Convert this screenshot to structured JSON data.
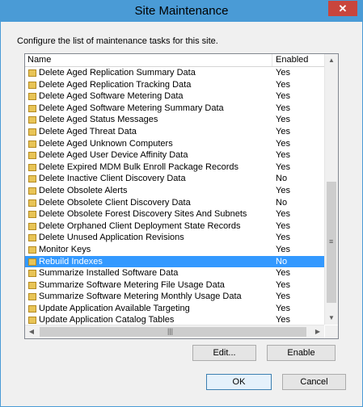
{
  "window": {
    "title": "Site Maintenance",
    "close_glyph": "✕"
  },
  "description": "Configure the list of maintenance tasks for this site.",
  "list": {
    "columns": {
      "name": "Name",
      "enabled": "Enabled"
    },
    "rows": [
      {
        "name": "Delete Aged Replication Summary Data",
        "enabled": "Yes",
        "icon": "task-folder-icon"
      },
      {
        "name": "Delete Aged Replication Tracking Data",
        "enabled": "Yes",
        "icon": "task-folder-icon"
      },
      {
        "name": "Delete Aged Software Metering Data",
        "enabled": "Yes",
        "icon": "task-folder-icon"
      },
      {
        "name": "Delete Aged Software Metering Summary Data",
        "enabled": "Yes",
        "icon": "task-folder-icon"
      },
      {
        "name": "Delete Aged Status Messages",
        "enabled": "Yes",
        "icon": "task-folder-icon"
      },
      {
        "name": "Delete Aged Threat Data",
        "enabled": "Yes",
        "icon": "task-folder-icon"
      },
      {
        "name": "Delete Aged Unknown Computers",
        "enabled": "Yes",
        "icon": "task-folder-icon"
      },
      {
        "name": "Delete Aged User Device Affinity Data",
        "enabled": "Yes",
        "icon": "task-folder-icon"
      },
      {
        "name": "Delete Expired MDM Bulk Enroll Package Records",
        "enabled": "Yes",
        "icon": "task-folder-icon"
      },
      {
        "name": "Delete Inactive Client Discovery Data",
        "enabled": "No",
        "icon": "task-folder-icon"
      },
      {
        "name": "Delete Obsolete Alerts",
        "enabled": "Yes",
        "icon": "task-folder-icon"
      },
      {
        "name": "Delete Obsolete Client Discovery Data",
        "enabled": "No",
        "icon": "task-folder-icon"
      },
      {
        "name": "Delete Obsolete Forest Discovery Sites And Subnets",
        "enabled": "Yes",
        "icon": "task-folder-icon"
      },
      {
        "name": "Delete Orphaned Client Deployment State Records",
        "enabled": "Yes",
        "icon": "task-folder-icon"
      },
      {
        "name": "Delete Unused Application Revisions",
        "enabled": "Yes",
        "icon": "task-folder-icon"
      },
      {
        "name": "Monitor Keys",
        "enabled": "Yes",
        "icon": "task-folder-icon"
      },
      {
        "name": "Rebuild Indexes",
        "enabled": "No",
        "icon": "task-folder-icon",
        "selected": true
      },
      {
        "name": "Summarize Installed Software Data",
        "enabled": "Yes",
        "icon": "task-folder-icon"
      },
      {
        "name": "Summarize Software Metering File Usage Data",
        "enabled": "Yes",
        "icon": "task-folder-icon"
      },
      {
        "name": "Summarize Software Metering Monthly Usage Data",
        "enabled": "Yes",
        "icon": "task-folder-icon"
      },
      {
        "name": "Update Application Available Targeting",
        "enabled": "Yes",
        "icon": "task-folder-icon"
      },
      {
        "name": "Update Application Catalog Tables",
        "enabled": "Yes",
        "icon": "task-folder-icon"
      }
    ]
  },
  "buttons": {
    "edit": "Edit...",
    "enable": "Enable",
    "ok": "OK",
    "cancel": "Cancel"
  },
  "colors": {
    "titlebar": "#4a9bd6",
    "selection": "#3399ff",
    "close": "#c9453c"
  }
}
